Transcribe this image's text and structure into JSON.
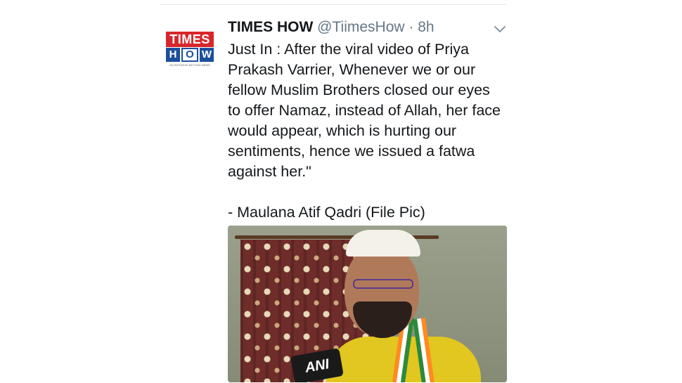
{
  "tweet": {
    "author_name": "TIMES HOW",
    "handle": "@TiimesHow",
    "separator": "·",
    "time": "8h",
    "text": "Just In : After the viral video of Priya\nPrakash Varrier, Whenever we or our\nfellow Muslim Brothers closed our eyes\nto offer Namaz, instead of Allah, her face\nwould appear, which is hurting our\nsentiments, hence we issued a fatwa\nagainst her.\"\n\n- Maulana Atif Qadri (File Pic)",
    "media_watermark": "ANI"
  },
  "avatar": {
    "logo_top": "TIMES",
    "logo_letters": [
      "H",
      "O",
      "W"
    ],
    "logo_tagline": "AN INITIATIVE BEYOND NEWS"
  },
  "icons": {
    "menu": "chevron-down-icon"
  },
  "colors": {
    "brand_red": "#d7262b",
    "brand_blue": "#1d4f9c",
    "text_primary": "#14171a",
    "text_secondary": "#657786",
    "divider": "#e1e8ed"
  }
}
